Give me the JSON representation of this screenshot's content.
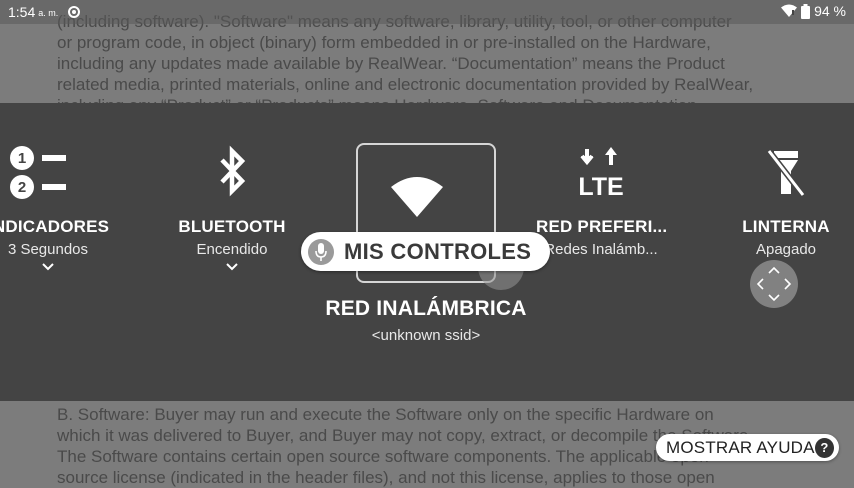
{
  "status_bar": {
    "time": "1:54",
    "ampm": "a. m.",
    "battery": "94 %"
  },
  "document": {
    "top_lines": [
      "(including software). \"Software\" means any software, library, utility, tool, or other computer",
      "or program code, in object (binary) form embedded in or pre-installed on the Hardware,",
      "including any updates made available by RealWear. “Documentation” means the Product",
      "related media, printed materials, online and electronic documentation provided by RealWear,",
      "including any “Product” or “Products” means Hardware, Software and Documentation."
    ],
    "bottom_lines": [
      "B. Software: Buyer may run and execute the Software only on the specific Hardware on",
      "which it was delivered to Buyer, and Buyer may not copy, extract, or decompile the Software.",
      "The Software contains certain open source software components. The applicable open",
      "source license (indicated in the header files), and not this license, applies to those open"
    ]
  },
  "controls": {
    "indicators": {
      "label": "INDICADORES",
      "sub": "3 Segundos",
      "icon": "numbered-list-icon"
    },
    "bluetooth": {
      "label": "BLUETOOTH",
      "sub": "Encendido",
      "icon": "bluetooth-icon"
    },
    "wireless": {
      "label": "RED INALÁMBRICA",
      "sub": "<unknown ssid>",
      "icon": "wifi-icon"
    },
    "preferred": {
      "label": "RED PREFERI...",
      "sub": "Redes Inalámb...",
      "icon": "lte-icon",
      "icon_text": "LTE"
    },
    "flashlight": {
      "label": "LINTERNA",
      "sub": "Apagado",
      "icon": "flashlight-off-icon"
    }
  },
  "voice": {
    "label": "MIS CONTROLES",
    "icon": "microphone-icon"
  },
  "help": {
    "label": "MOSTRAR AYUDA",
    "q": "?"
  },
  "colors": {
    "panel": "#444444",
    "background": "#7c7c7c",
    "pill": "#ffffff"
  }
}
